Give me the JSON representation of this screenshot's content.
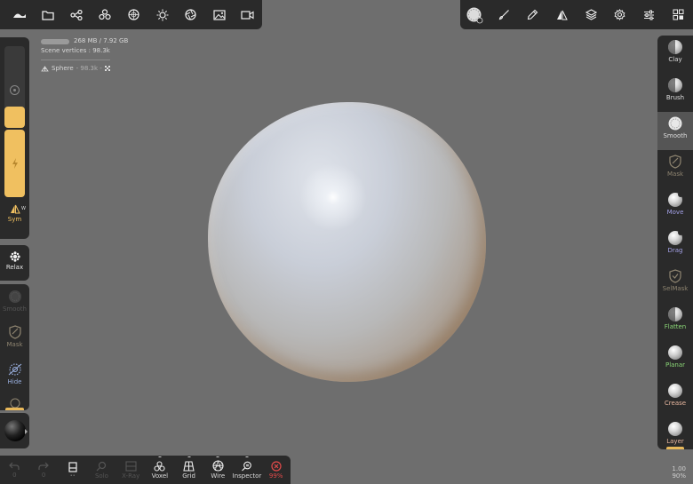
{
  "stats": {
    "memory": "268 MB / 7.92 GB",
    "scene_vertices": "Scene vertices : 98.3k",
    "mesh_name": "Sphere",
    "mesh_info": " - 98.3k -"
  },
  "top_left_icons": [
    "nomad-logo-icon",
    "folder-icon",
    "scene-graph-icon",
    "primitives-icon",
    "material-sphere-icon",
    "light-icon",
    "camera-aperture-icon",
    "image-icon",
    "video-icon"
  ],
  "top_right_icons": [
    "brush-alpha-icon",
    "paint-brush-icon",
    "pen-icon",
    "symmetry-icon",
    "layers-icon",
    "settings-gear-icon",
    "sliders-icon",
    "grid-dots-icon"
  ],
  "left": {
    "sym_label": "Sym",
    "sym_w": "W",
    "relax_label": "Relax",
    "smooth_label": "Smooth",
    "mask_label": "Mask",
    "hide_label": "Hide"
  },
  "tools": [
    {
      "label": "Clay",
      "color": "#dddddd"
    },
    {
      "label": "Brush",
      "color": "#dddddd"
    },
    {
      "label": "Smooth",
      "color": "#dddddd"
    },
    {
      "label": "Mask",
      "color": "#8e8470"
    },
    {
      "label": "Move",
      "color": "#a3a0e6"
    },
    {
      "label": "Drag",
      "color": "#a3a0e6"
    },
    {
      "label": "SelMask",
      "color": "#8e8470"
    },
    {
      "label": "Flatten",
      "color": "#8ad676"
    },
    {
      "label": "Planar",
      "color": "#8ad676"
    },
    {
      "label": "Crease",
      "color": "#e6b59e"
    },
    {
      "label": "Layer",
      "color": "#e6b59e"
    }
  ],
  "bottom": {
    "undo_count": "0",
    "redo_count": "0",
    "solo_label": "Solo",
    "xray_label": "X-Ray",
    "voxel_label": "Voxel",
    "grid_label": "Grid",
    "wire_label": "Wire",
    "inspector_label": "Inspector",
    "zoom_label": "99%"
  },
  "readout": {
    "value1": "1.00",
    "value2": "90%"
  },
  "colors": {
    "accent": "#f0c060",
    "panel": "#2a2a2a",
    "viewport": "#6e6e6e",
    "danger": "#e24a4a"
  }
}
